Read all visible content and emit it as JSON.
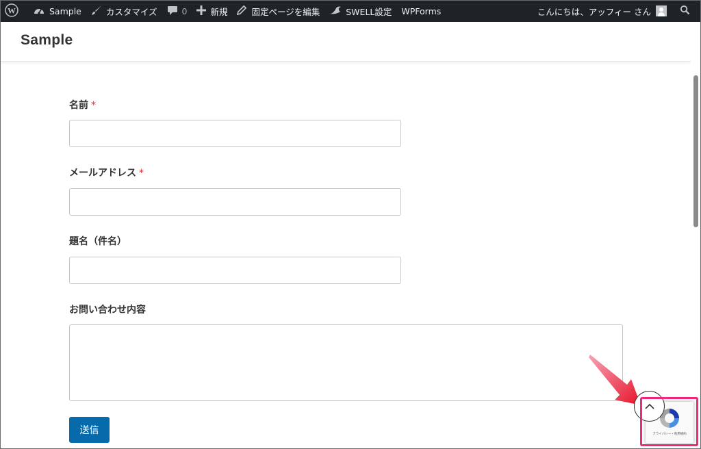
{
  "adminbar": {
    "site_name": "Sample",
    "customize": "カスタマイズ",
    "comments_count": "0",
    "new": "新規",
    "edit_page": "固定ページを編集",
    "swell_settings": "SWELL設定",
    "wpforms": "WPForms",
    "greeting": "こんにちは、アッフィー さん"
  },
  "header": {
    "site_title": "Sample"
  },
  "form": {
    "name_label": "名前",
    "email_label": "メールアドレス",
    "subject_label": "題名（件名）",
    "message_label": "お問い合わせ内容",
    "required_mark": "*",
    "submit_label": "送信"
  },
  "recaptcha": {
    "footer_text": "プライバシー・利用規約"
  },
  "colors": {
    "adminbar_bg": "#1d2327",
    "button": "#066aab",
    "highlight": "#f0287a",
    "required": "#d63638"
  }
}
